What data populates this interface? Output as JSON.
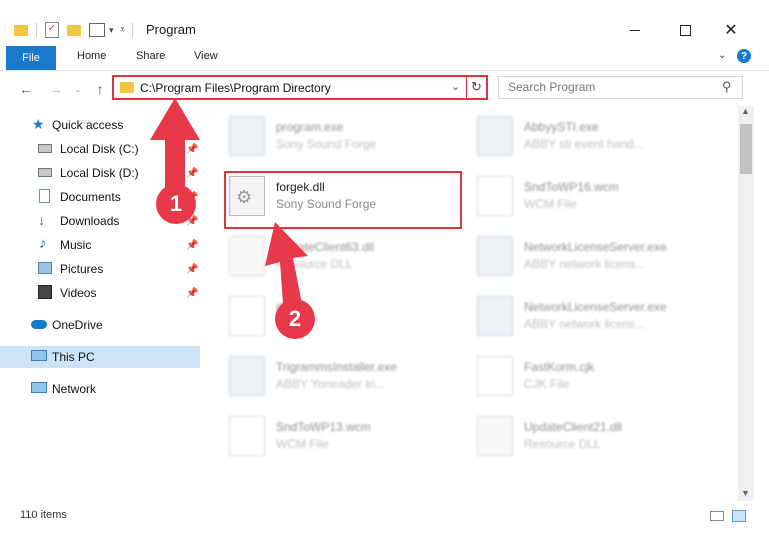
{
  "window": {
    "title": "Program",
    "minimize_icon": "minimize-icon",
    "maximize_icon": "maximize-icon",
    "close_icon": "close-icon"
  },
  "ribbon": {
    "tabs": [
      "File",
      "Home",
      "Share",
      "View"
    ]
  },
  "address_bar": {
    "path": "C:\\Program Files\\Program Directory"
  },
  "search": {
    "placeholder": "Search Program"
  },
  "sidebar": {
    "items": [
      {
        "label": "Quick access",
        "icon": "star-icon"
      },
      {
        "label": "Local Disk (C:)",
        "icon": "drive-icon"
      },
      {
        "label": "Local Disk (D:)",
        "icon": "drive-icon"
      },
      {
        "label": "Documents",
        "icon": "documents-icon"
      },
      {
        "label": "Downloads",
        "icon": "download-icon"
      },
      {
        "label": "Music",
        "icon": "music-icon"
      },
      {
        "label": "Pictures",
        "icon": "pictures-icon"
      },
      {
        "label": "Videos",
        "icon": "videos-icon"
      },
      {
        "label": "OneDrive",
        "icon": "cloud-icon"
      },
      {
        "label": "This PC",
        "icon": "computer-icon"
      },
      {
        "label": "Network",
        "icon": "network-icon"
      }
    ]
  },
  "files": {
    "left": [
      {
        "name": "program.exe",
        "sub": "Sony Sound Forge"
      },
      {
        "name": "forgek.dll",
        "sub": "Sony Sound Forge"
      },
      {
        "name": "UpdateClient63.dll",
        "sub": "Resource DLL"
      },
      {
        "name": "d3d9",
        "sub": ""
      },
      {
        "name": "TrigrammsInstaller.exe",
        "sub": "ABBY Yoneader tri..."
      },
      {
        "name": "SndToWP13.wcm",
        "sub": "WCM File"
      }
    ],
    "right": [
      {
        "name": "AbbyySTI.exe",
        "sub": "ABBY sti event hand..."
      },
      {
        "name": "SndToWP16.wcm",
        "sub": "WCM File"
      },
      {
        "name": "NetworkLicenseServer.exe",
        "sub": "ABBY network licens..."
      },
      {
        "name": "NetworkLicenseServer.exe",
        "sub": "ABBY network licens..."
      },
      {
        "name": "FastKorm.cjk",
        "sub": "CJK File"
      },
      {
        "name": "UpdateClient21.dll",
        "sub": "Resource DLL"
      }
    ]
  },
  "status": {
    "count": "110 items"
  },
  "callouts": [
    "1",
    "2"
  ],
  "colors": {
    "accent": "#1979ca",
    "highlight": "#d9363e",
    "callout": "#e8394a"
  }
}
